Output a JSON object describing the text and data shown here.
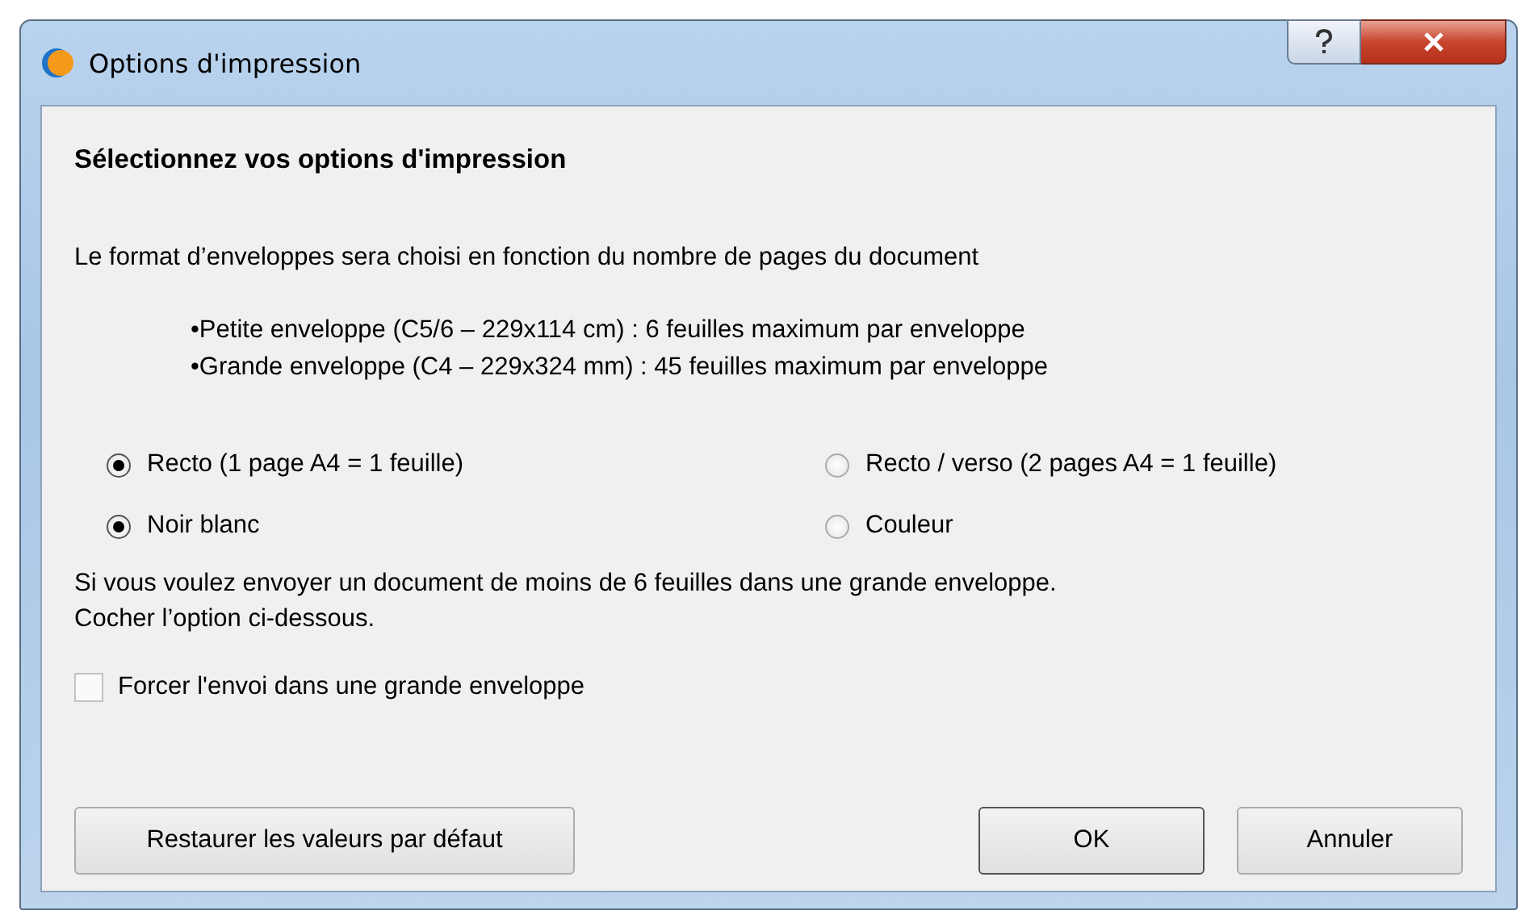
{
  "window": {
    "title": "Options d'impression"
  },
  "heading": "Sélectionnez vos options d'impression",
  "intro": "Le format d’enveloppes sera choisi en fonction du nombre de pages du document",
  "bullets": [
    "•Petite enveloppe (C5/6 – 229x114 cm) : 6 feuilles maximum par enveloppe",
    "•Grande enveloppe (C4 – 229x324 mm) : 45 feuilles maximum par enveloppe"
  ],
  "radio_rows": [
    {
      "options": [
        {
          "label": "Recto (1 page A4 = 1 feuille)",
          "selected": true
        },
        {
          "label": "Recto / verso (2 pages A4 = 1 feuille)",
          "selected": false
        }
      ]
    },
    {
      "options": [
        {
          "label": "Noir  blanc",
          "selected": true
        },
        {
          "label": "Couleur",
          "selected": false
        }
      ]
    }
  ],
  "note": [
    "Si vous voulez envoyer un document de moins de 6 feuilles dans une grande enveloppe.",
    "Cocher l’option ci-dessous."
  ],
  "checkbox": {
    "label": "Forcer l'envoi dans une grande enveloppe",
    "checked": false
  },
  "buttons": {
    "reset": "Restaurer les valeurs par défaut",
    "ok": "OK",
    "cancel": "Annuler"
  }
}
